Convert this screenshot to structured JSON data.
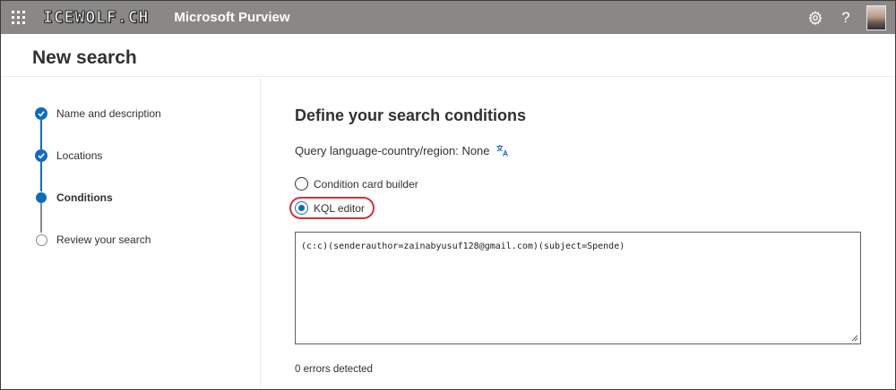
{
  "topbar": {
    "waffle_icon": "waffle-icon",
    "brand_logo": "ICEWOLF.CH",
    "app_name": "Microsoft Purview",
    "settings_icon": "gear-icon",
    "help_label": "?",
    "help_icon": "help-icon",
    "avatar_icon": "user-avatar"
  },
  "header": {
    "title": "New search"
  },
  "stepper": {
    "steps": [
      {
        "label": "Name and description",
        "state": "completed"
      },
      {
        "label": "Locations",
        "state": "completed"
      },
      {
        "label": "Conditions",
        "state": "current"
      },
      {
        "label": "Review your search",
        "state": "pending"
      }
    ]
  },
  "main": {
    "title": "Define your search conditions",
    "query_language": "Query language-country/region: None",
    "language_icon": "language-settings-icon",
    "options": [
      {
        "label": "Condition card builder",
        "selected": false
      },
      {
        "label": "KQL editor",
        "selected": true
      }
    ],
    "kql_query": "(c:c)(senderauthor=zainabyusuf128@gmail.com)(subject=Spende)",
    "errors": "0 errors detected"
  },
  "colors": {
    "topbar": "#8a8886",
    "accent": "#0f6cbd",
    "highlight": "#d13438"
  }
}
